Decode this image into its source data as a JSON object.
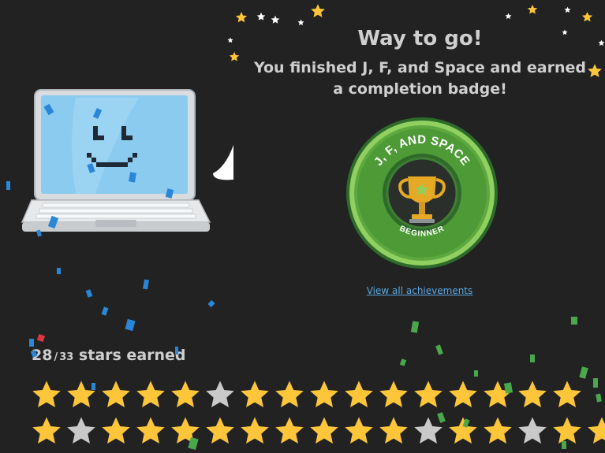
{
  "header": {
    "title": "Way to go!",
    "subtitle_line1": "You finished J, F, and Space and earned",
    "subtitle_line2": "a completion badge!"
  },
  "badge": {
    "name": "J, F, AND SPACE",
    "level": "BEGINNER",
    "icon": "trophy-icon"
  },
  "links": {
    "view_all": "View all achievements"
  },
  "stars": {
    "earned": "28",
    "separator": "/",
    "total": "33",
    "label": "stars earned",
    "row1": [
      true,
      true,
      true,
      true,
      true,
      false,
      true,
      true,
      true,
      true,
      true,
      true,
      true,
      true,
      true,
      true
    ],
    "row2": [
      true,
      false,
      true,
      true,
      true,
      true,
      true,
      true,
      true,
      true,
      true,
      false,
      true,
      true,
      false,
      true,
      true
    ]
  },
  "colors": {
    "background": "#222223",
    "star_filled": "#fdc539",
    "star_empty": "#c9c9c9",
    "badge_green": "#7bc24e",
    "link": "#5aa8e0",
    "laptop_screen": "#8ccbf0"
  }
}
